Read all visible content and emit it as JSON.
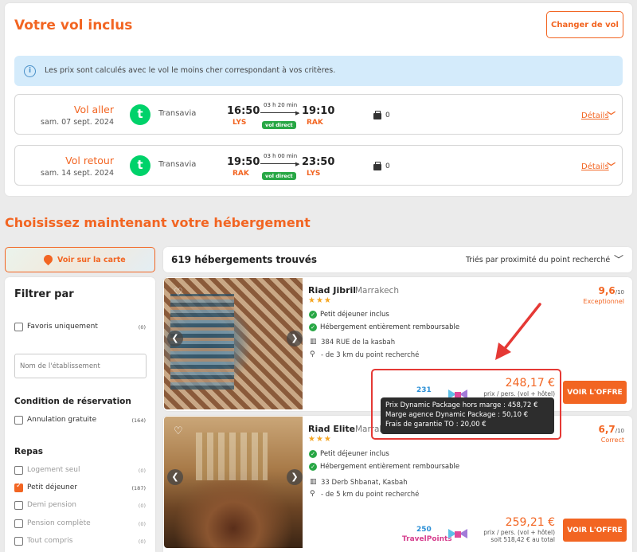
{
  "flight": {
    "title": "Votre vol inclus",
    "change_label": "Changer de vol",
    "info": "Les prix sont calculés avec le vol le moins cher correspondant à vos critères.",
    "outbound": {
      "label": "Vol aller",
      "date": "sam. 07 sept. 2024",
      "airline": "Transavia",
      "logo_letter": "t",
      "dep_time": "16:50",
      "dep_code": "LYS",
      "duration": "03 h 20 min",
      "arr_time": "19:10",
      "arr_code": "RAK",
      "direct": "vol direct",
      "bags": "0",
      "details": "Détails"
    },
    "return": {
      "label": "Vol retour",
      "date": "sam. 14 sept. 2024",
      "airline": "Transavia",
      "logo_letter": "t",
      "dep_time": "19:50",
      "dep_code": "RAK",
      "duration": "03 h 00 min",
      "arr_time": "23:50",
      "arr_code": "LYS",
      "direct": "vol direct",
      "bags": "0",
      "details": "Détails"
    }
  },
  "accommodation": {
    "title": "Choisissez maintenant votre hébergement",
    "map_button": "Voir sur la carte",
    "results_count": "619 hébergements trouvés",
    "sort": "Triés par proximité du point recherché"
  },
  "filters": {
    "title": "Filtrer par",
    "favorites": {
      "label": "Favoris uniquement",
      "count": "(0)"
    },
    "name_placeholder": "Nom de l'établissement",
    "booking_heading": "Condition de réservation",
    "free_cancel": {
      "label": "Annulation gratuite",
      "count": "(164)"
    },
    "meals_heading": "Repas",
    "meals": [
      {
        "label": "Logement seul",
        "count": "(0)",
        "checked": false
      },
      {
        "label": "Petit déjeuner",
        "count": "(187)",
        "checked": true
      },
      {
        "label": "Demi pension",
        "count": "(0)",
        "checked": false
      },
      {
        "label": "Pension complète",
        "count": "(0)",
        "checked": false
      },
      {
        "label": "Tout compris",
        "count": "(0)",
        "checked": false
      }
    ]
  },
  "hotels": [
    {
      "name": "Riad Jibril",
      "city": "Marrakech",
      "stars": "★★★",
      "features": [
        "Petit déjeuner inclus",
        "Hébergement entièrement remboursable"
      ],
      "address": "384 RUE de la kasbah",
      "distance": "- de 3 km du point recherché",
      "rating": "9,6",
      "rating_max": "/10",
      "rating_label": "Exceptionnel",
      "points": "231",
      "price": "248,17 €",
      "price_sub": "prix / pers. (vol + hôtel)",
      "offer": "VOIR L'OFFRE"
    },
    {
      "name": "Riad Elite",
      "city": "Marrakech",
      "stars": "★★★",
      "features": [
        "Petit déjeuner inclus",
        "Hébergement entièrement remboursable"
      ],
      "address": "33 Derb Shbanat, Kasbah",
      "distance": "- de 5 km du point recherché",
      "rating": "6,7",
      "rating_max": "/10",
      "rating_label": "Correct",
      "points": "250",
      "points_brand": "TravelPoints",
      "price": "259,21 €",
      "price_sub": "prix / pers. (vol + hôtel)",
      "price_total": "soit 518,42 € au total",
      "offer": "VOIR L'OFFRE"
    }
  ],
  "tooltip": {
    "line1": "Prix Dynamic Package hors marge : 458,72 €",
    "line2": "Marge agence Dynamic Package : 50,10 €",
    "line3": "Frais de garantie TO : 20,00 €"
  },
  "colors": {
    "accent": "#f26522",
    "success": "#28a745",
    "info_bg": "#d4ebfb",
    "annotation": "#e53935"
  },
  "icons": [
    "info-icon",
    "airline-logo",
    "luggage-icon",
    "chevron-down-icon",
    "map-pin-icon",
    "heart-icon",
    "chevron-left-icon",
    "chevron-right-icon",
    "check-circle-icon",
    "building-icon",
    "location-pin-icon",
    "travelpoints-logo"
  ]
}
